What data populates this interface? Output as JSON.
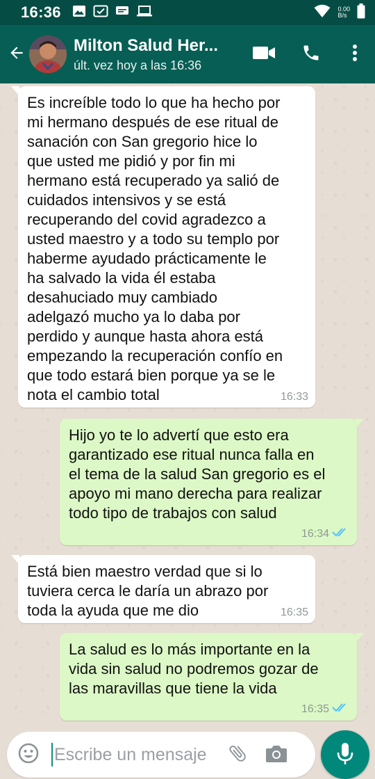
{
  "statusbar": {
    "time": "16:36",
    "speed_value": "0.00",
    "speed_unit": "B/s",
    "icons": [
      "image-icon",
      "checkbox-icon",
      "message-icon",
      "laptop-icon",
      "wifi-icon",
      "battery-icon"
    ]
  },
  "header": {
    "contact_name": "Milton Salud Her...",
    "last_seen": "últ. vez hoy a las 16:36",
    "icons": [
      "back-arrow-icon",
      "video-call-icon",
      "phone-call-icon",
      "more-vert-icon"
    ]
  },
  "messages": [
    {
      "direction": "incoming",
      "text": "Es increíble todo lo que ha hecho por\nmi hermano después de ese ritual de\nsanación con San gregorio hice lo\nque usted me pidió y por fin mi\nhermano está recuperado ya salió de\ncuidados intensivos y se está\nrecuperando del covid agradezco a\nusted maestro y a todo su templo por\nhaberme ayudado prácticamente le\nha salvado la vida él estaba\ndesahuciado muy cambiado\nadelgazó mucho ya lo daba por\nperdido y aunque hasta ahora está\nempezando la recuperación confío en\nque todo estará bien porque ya se le\nnota el cambio total",
      "time": "16:33"
    },
    {
      "direction": "outgoing",
      "text": "Hijo yo te lo advertí que esto era\ngarantizado ese ritual nunca falla en\nel tema de la salud San gregorio es el\napoyo mi mano derecha para realizar\ntodo tipo de trabajos con salud",
      "time": "16:34",
      "read": true
    },
    {
      "direction": "incoming",
      "text": "Está bien maestro verdad que si lo\ntuviera cerca le daría un abrazo por\ntoda la ayuda que me dio",
      "time": "16:35"
    },
    {
      "direction": "outgoing",
      "text": "La salud es lo más importante en la\nvida sin salud no podremos gozar de\nlas maravillas que tiene la vida",
      "time": "16:35",
      "read": true
    }
  ],
  "composer": {
    "placeholder": "Escribe un mensaje",
    "icons": [
      "emoji-icon",
      "attach-icon",
      "camera-icon",
      "mic-icon"
    ]
  },
  "colors": {
    "statusbar": "#054d44",
    "header": "#075e54",
    "incoming_bubble": "#ffffff",
    "outgoing_bubble": "#dcf8c6",
    "read_ticks": "#4fc3f7",
    "mic_button": "#00897b"
  }
}
